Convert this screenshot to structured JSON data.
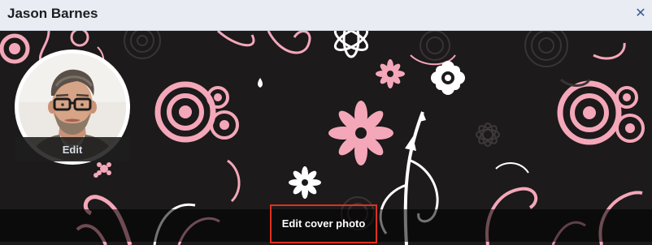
{
  "dialog": {
    "title": "Jason Barnes",
    "close_icon": "close-icon"
  },
  "cover": {
    "edit_cover_label": "Edit cover photo",
    "pattern_colors": [
      "#f4a7b9",
      "#ffffff",
      "#2a2527"
    ]
  },
  "profile": {
    "edit_label": "Edit"
  },
  "colors": {
    "titlebar_bg": "#e9ecf3",
    "close_color": "#3b5998",
    "highlight_border": "#e0301e"
  }
}
